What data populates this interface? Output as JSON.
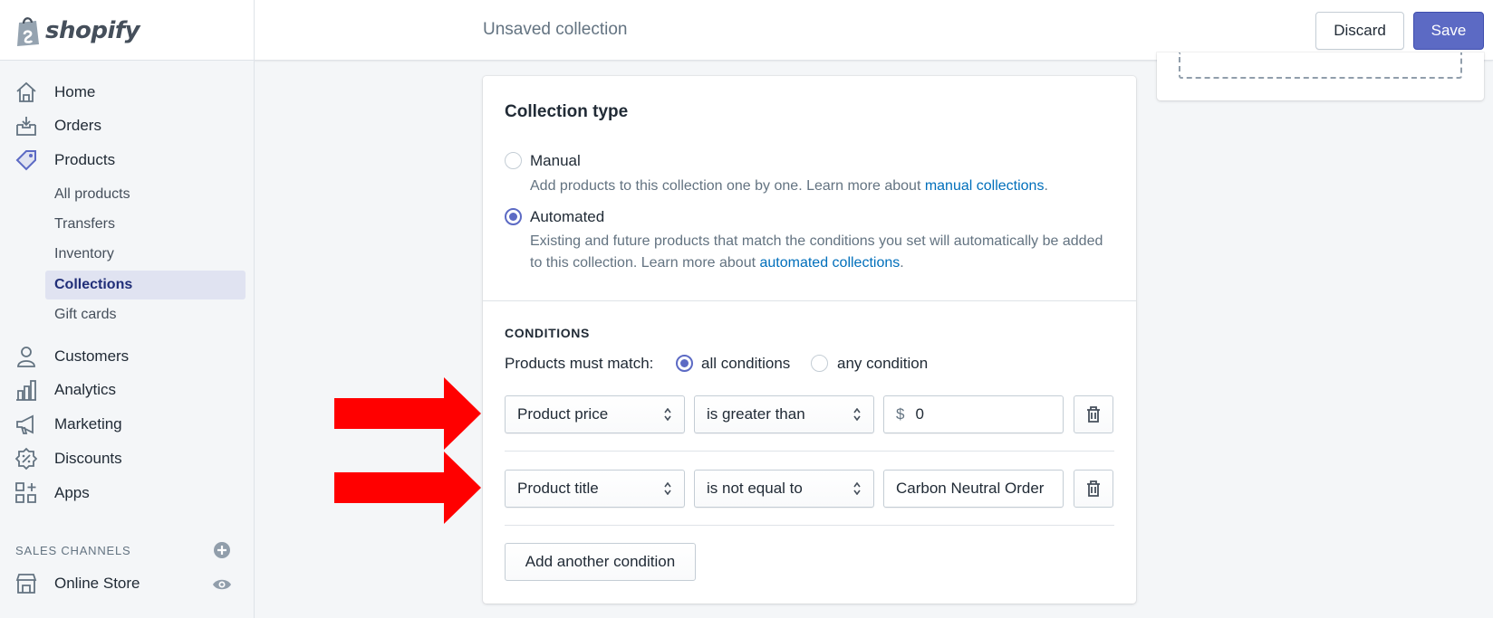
{
  "header": {
    "logo_text": "shopify",
    "page_title": "Unsaved collection",
    "discard_label": "Discard",
    "save_label": "Save"
  },
  "sidebar": {
    "items": [
      {
        "label": "Home",
        "icon": "home-icon"
      },
      {
        "label": "Orders",
        "icon": "orders-icon"
      },
      {
        "label": "Products",
        "icon": "tag-icon"
      },
      {
        "label": "Customers",
        "icon": "person-icon"
      },
      {
        "label": "Analytics",
        "icon": "bar-chart-icon"
      },
      {
        "label": "Marketing",
        "icon": "megaphone-icon"
      },
      {
        "label": "Discounts",
        "icon": "discount-icon"
      },
      {
        "label": "Apps",
        "icon": "apps-icon"
      }
    ],
    "product_subitems": [
      "All products",
      "Transfers",
      "Inventory",
      "Collections",
      "Gift cards"
    ],
    "selected_subitem": "Collections",
    "sales_channels_heading": "SALES CHANNELS",
    "online_store_label": "Online Store"
  },
  "collection_type": {
    "title": "Collection type",
    "manual_label": "Manual",
    "manual_help": "Add products to this collection one by one. Learn more about ",
    "manual_link": "manual collections",
    "automated_label": "Automated",
    "automated_help": "Existing and future products that match the conditions you set will automatically be added to this collection. Learn more about ",
    "automated_link": "automated collections",
    "selected": "Automated"
  },
  "conditions": {
    "heading": "CONDITIONS",
    "match_label": "Products must match:",
    "all_label": "all conditions",
    "any_label": "any condition",
    "match_selected": "all conditions",
    "rows": [
      {
        "field": "Product price",
        "operator": "is greater than",
        "prefix": "$",
        "value": "0"
      },
      {
        "field": "Product title",
        "operator": "is not equal to",
        "prefix": "",
        "value": "Carbon Neutral Order"
      }
    ],
    "add_label": "Add another condition"
  },
  "colors": {
    "accent": "#5c6ac4",
    "link": "#006fbb",
    "annotation_arrow": "#ff0000"
  }
}
